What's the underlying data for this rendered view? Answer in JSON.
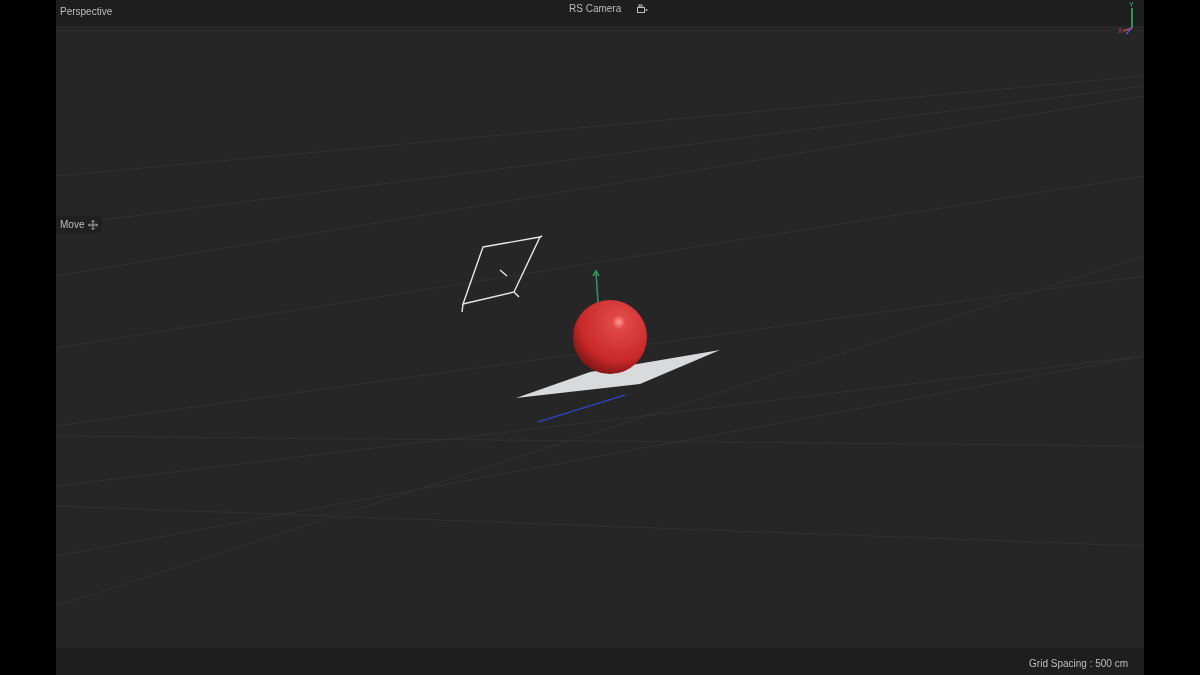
{
  "viewport": {
    "view_name": "Perspective",
    "camera": "RS Camera",
    "axis_labels": [
      "Y",
      "X"
    ]
  },
  "tool": {
    "label": "Move"
  },
  "status_bar": {
    "grid_spacing": "Grid Spacing : 500 cm"
  }
}
